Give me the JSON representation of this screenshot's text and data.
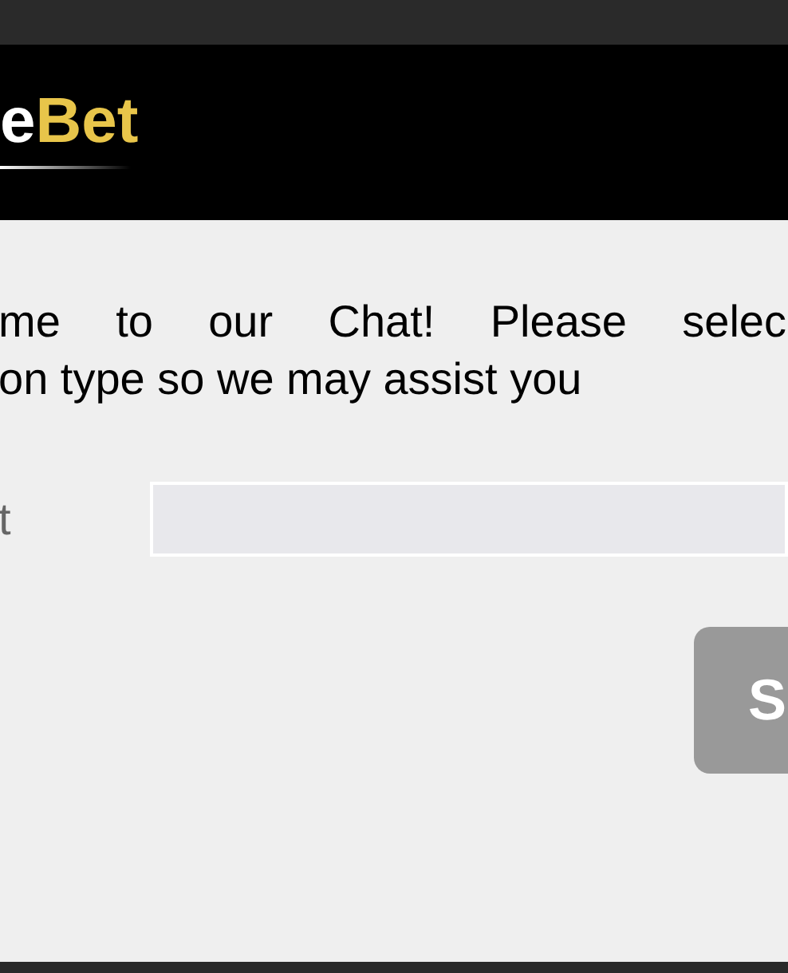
{
  "header": {
    "logo": {
      "part_1": "e",
      "part_2": "Bet"
    }
  },
  "welcome": {
    "line_1": "me to our Chat! Please selec",
    "line_2": "on type so we may assist you"
  },
  "form": {
    "label": "t"
  },
  "submit_button": {
    "label": "S",
    "disabled": true
  }
}
